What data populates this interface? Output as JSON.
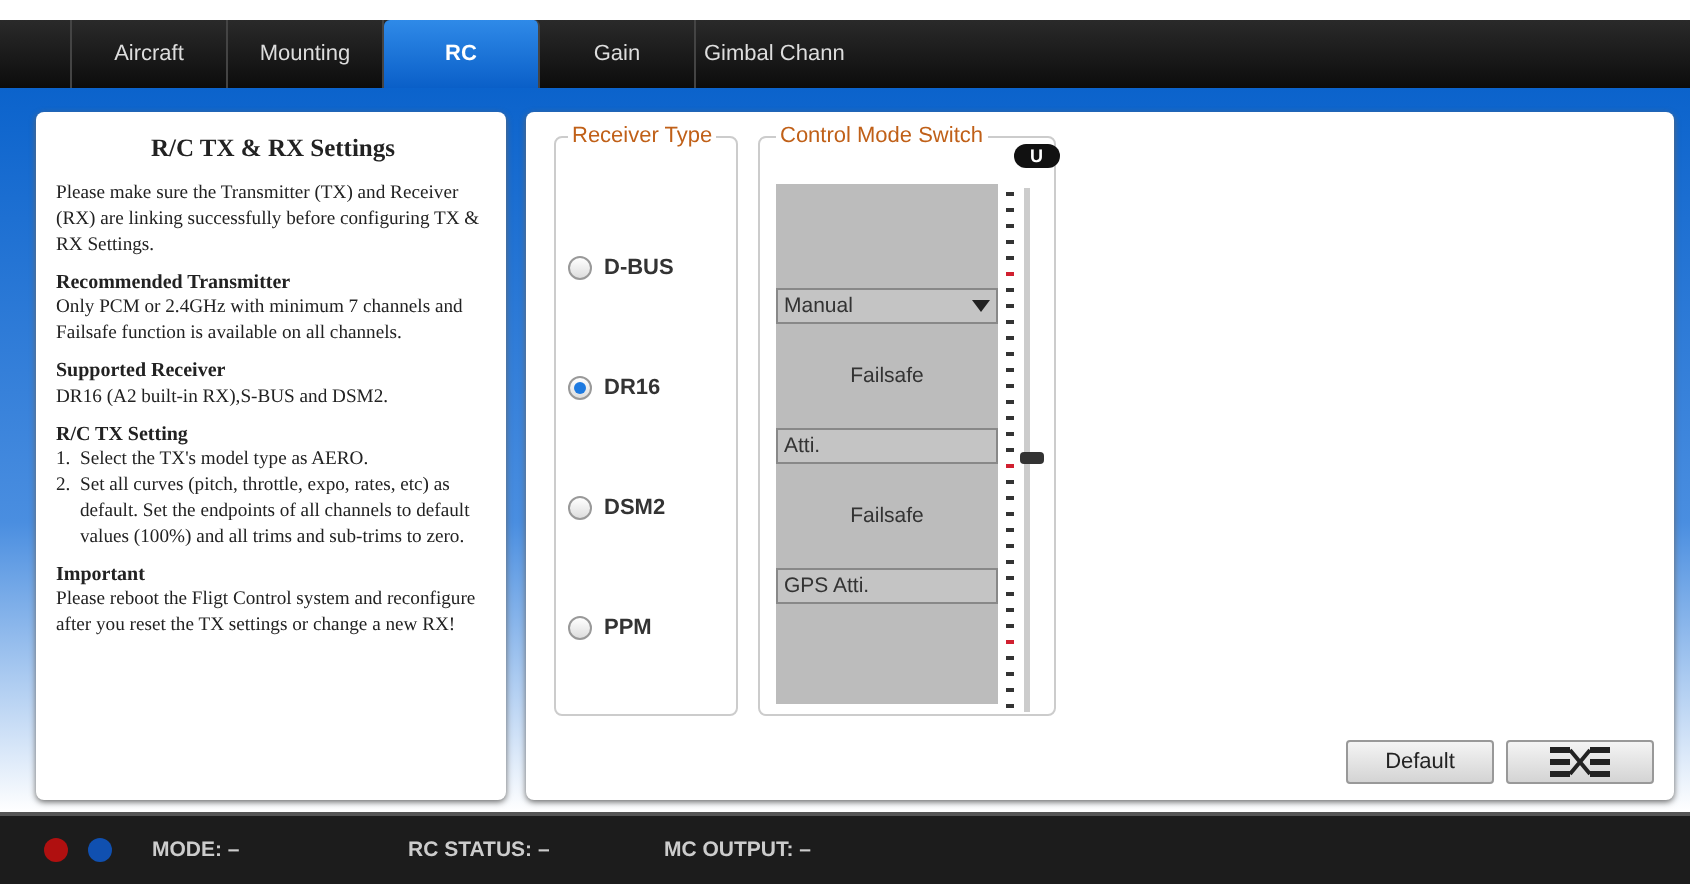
{
  "tabs": [
    {
      "label": "Aircraft",
      "selected": false
    },
    {
      "label": "Mounting",
      "selected": false
    },
    {
      "label": "RC",
      "selected": true
    },
    {
      "label": "Gain",
      "selected": false
    },
    {
      "label": "Gimbal Chann",
      "selected": false
    }
  ],
  "info_panel": {
    "title": "R/C TX & RX Settings",
    "sections": [
      {
        "text": "Please make sure the Transmitter (TX) and Receiver (RX) are linking successfully before configuring TX & RX Settings."
      },
      {
        "heading": "Recommended Transmitter",
        "text": "Only PCM or 2.4GHz with minimum 7 channels and Failsafe function is available on all channels."
      },
      {
        "heading": "Supported Receiver",
        "text": "DR16 (A2 built-in RX),S-BUS and DSM2."
      },
      {
        "heading": "R/C TX Setting",
        "steps": [
          {
            "number": "1.",
            "text": "Select the TX's model type as AERO."
          },
          {
            "number": "2.",
            "text": "Set all curves (pitch, throttle, expo, rates, etc) as default. Set the endpoints of all channels to default values (100%) and all trims and sub-trims to zero."
          }
        ]
      },
      {
        "heading": "Important",
        "text": "Please reboot the Fligt Control system and reconfigure after you reset the TX settings or change a new RX!"
      }
    ]
  },
  "receiver_type": {
    "title": "Receiver Type",
    "options": [
      {
        "label": "D-BUS",
        "selected": false
      },
      {
        "label": "DR16",
        "selected": true
      },
      {
        "label": "DSM2",
        "selected": false
      },
      {
        "label": "PPM",
        "selected": false
      }
    ]
  },
  "control_mode_switch": {
    "title": "Control Mode Switch",
    "channel_label": "U",
    "level": 0.49,
    "modes": [
      {
        "kind": "dropdown",
        "label": "Manual"
      },
      {
        "kind": "note",
        "label": "Failsafe"
      },
      {
        "kind": "field",
        "label": "Atti."
      },
      {
        "kind": "note",
        "label": "Failsafe"
      },
      {
        "kind": "field",
        "label": "GPS Atti."
      }
    ]
  },
  "buttons": [
    {
      "kind": "text",
      "label": "Default"
    },
    {
      "kind": "icon"
    }
  ],
  "status_bar": {
    "leds": [
      {
        "color": "#b01010"
      },
      {
        "color": "#1050b0"
      }
    ],
    "items": [
      {
        "label": "MODE:",
        "value": "–"
      },
      {
        "label": "RC STATUS:",
        "value": "–"
      },
      {
        "label": "MC OUTPUT:",
        "value": "–"
      }
    ]
  }
}
